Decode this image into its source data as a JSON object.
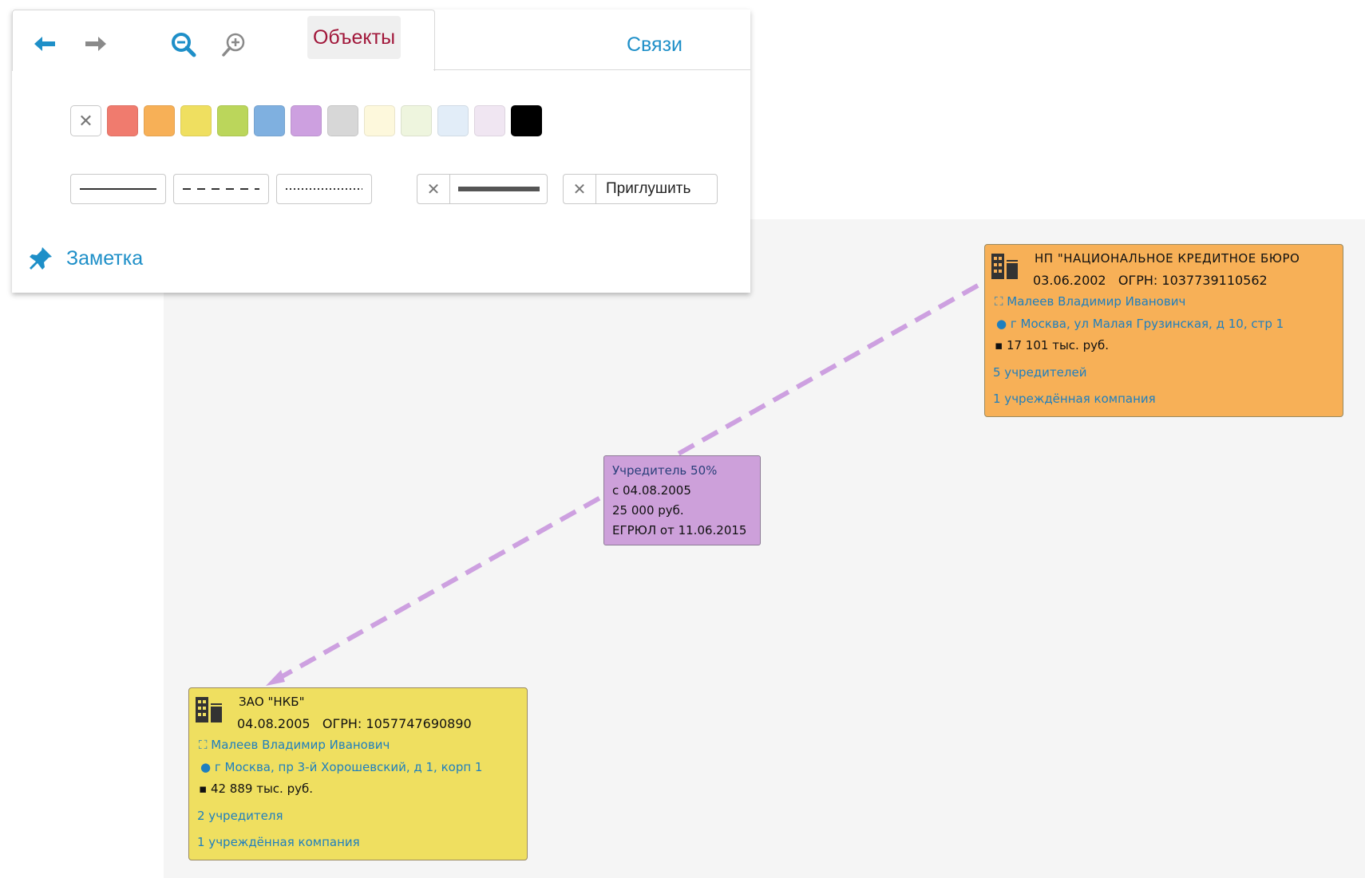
{
  "toolbar": {
    "icons": [
      "arrow-left-icon",
      "arrow-right-icon",
      "zoom-out-icon",
      "zoom-in-icon"
    ],
    "objects_tab": "Объекты",
    "links_tab": "Связи",
    "swatch_colors": [
      "#f07b6e",
      "#f7b057",
      "#efdf60",
      "#bbd65b",
      "#7fb0e0",
      "#cda0e0",
      "#d7d7d7",
      "#fdf8dc",
      "#eef5de",
      "#e2edf8",
      "#f0e6f2",
      "#000000"
    ],
    "mute_label": "Приглушить",
    "note_label": "Заметка"
  },
  "nodes": {
    "nkb_np": {
      "color": "#f7b057",
      "title": "НП \"НАЦИОНАЛЬНОЕ КРЕДИТНОЕ БЮРО",
      "date": "03.06.2002",
      "ogrn": "ОГРН: 1037739110562",
      "person": "Малеев Владимир Иванович",
      "address": "г Москва, ул Малая Грузинская, д 10, стр 1",
      "capital": "17 101 тыс. руб.",
      "founders": "5 учредителей",
      "subsidiaries": "1 учреждённая компания"
    },
    "nkb_zao": {
      "color": "#efdf60",
      "title": "ЗАО \"НКБ\"",
      "date": "04.08.2005",
      "ogrn": "ОГРН: 1057747690890",
      "person": "Малеев Владимир Иванович",
      "address": "г Москва, пр 3-й Хорошевский, д 1, корп 1",
      "capital": "42 889 тыс. руб.",
      "founders": "2 учредителя",
      "subsidiaries": "1 учреждённая компания"
    }
  },
  "edge": {
    "color": "#cda0da",
    "role": "Учредитель 50%",
    "since": "с 04.08.2005",
    "amount": "25 000 руб.",
    "source": "ЕГРЮЛ от 11.06.2015"
  }
}
